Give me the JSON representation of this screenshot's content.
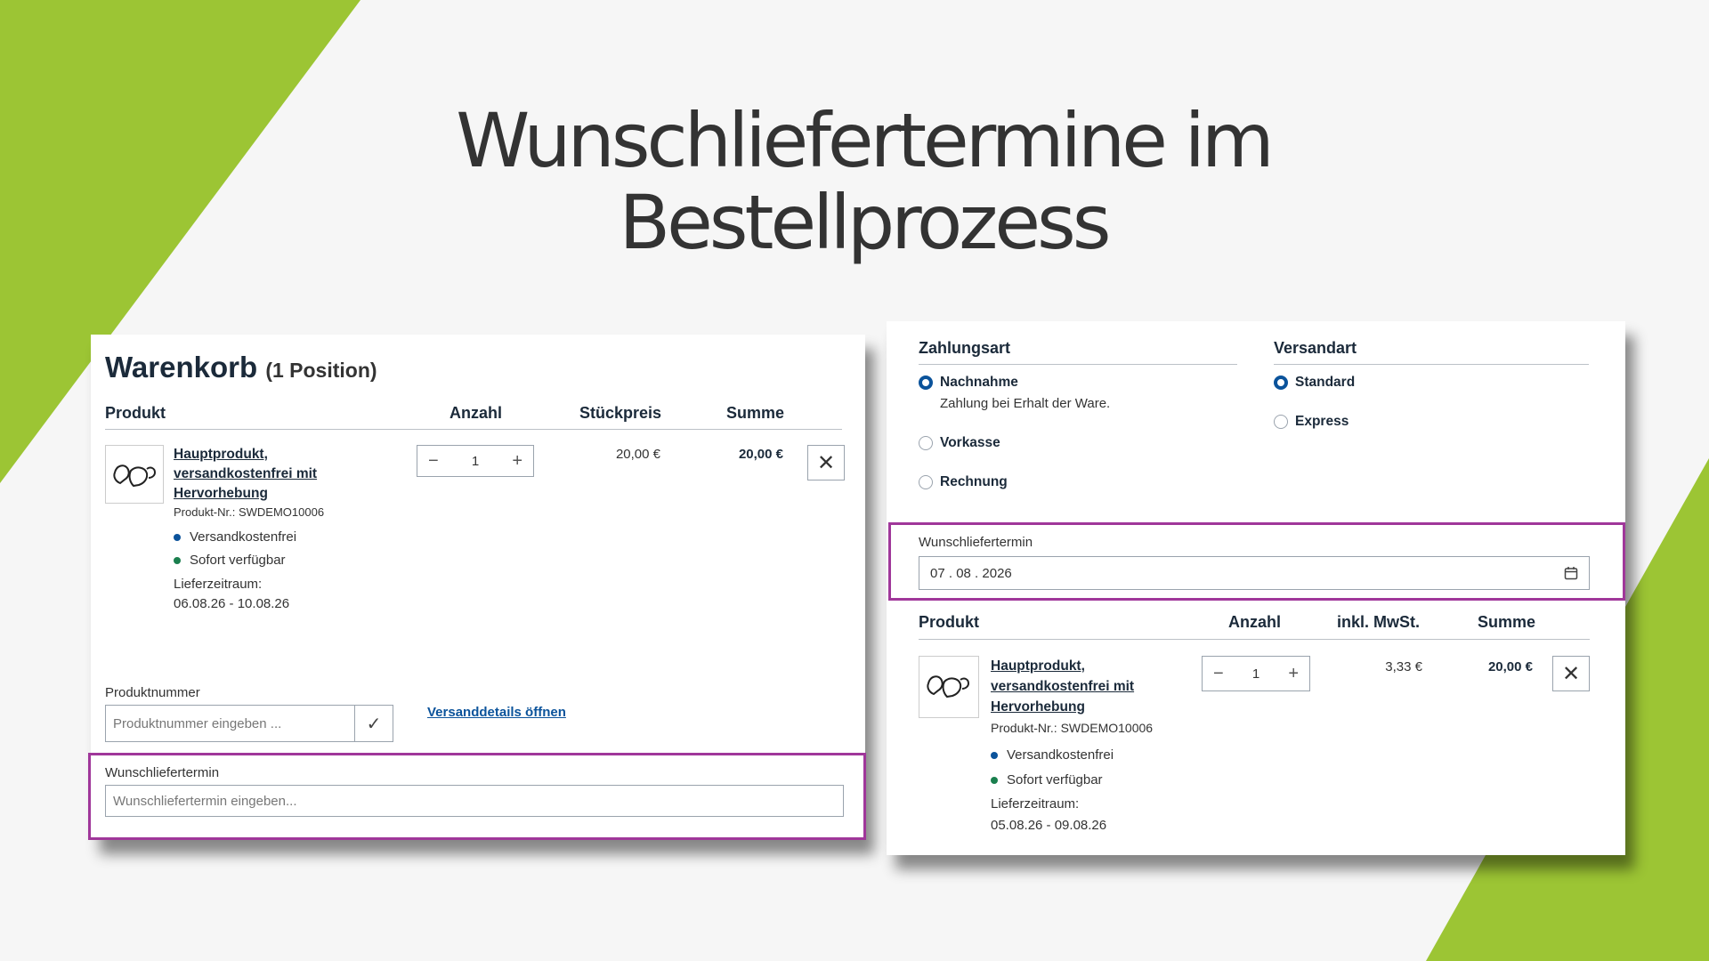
{
  "slide": {
    "title_line1": "Wunschliefertermine im",
    "title_line2": "Bestellprozess",
    "accent_color": "#9cc534",
    "highlight_color": "#a0379a"
  },
  "cart": {
    "heading": "Warenkorb",
    "count": "(1 Position)",
    "columns": {
      "product": "Produkt",
      "qty": "Anzahl",
      "unit_price": "Stückpreis",
      "total": "Summe"
    },
    "item": {
      "name_l1": "Hauptprodukt,",
      "name_l2": "versandkostenfrei mit",
      "name_l3": "Hervorhebung",
      "number": "Produkt-Nr.: SWDEMO10006",
      "badge1": "Versandkostenfrei",
      "badge2": "Sofort verfügbar",
      "delivery_label": "Lieferzeitraum:",
      "delivery_range": "06.08.26 - 10.08.26",
      "qty": "1",
      "qty_minus": "−",
      "qty_plus": "+",
      "unit_price": "20,00 €",
      "total": "20,00 €",
      "remove": "✕"
    },
    "product_number_label": "Produktnummer",
    "product_number_placeholder": "Produktnummer eingeben ...",
    "submit_icon": "✓",
    "shipping_link": "Versanddetails öffnen",
    "wish_label": "Wunschliefertermin",
    "wish_placeholder": "Wunschliefertermin eingeben..."
  },
  "checkout": {
    "payment_heading": "Zahlungsart",
    "shipping_heading": "Versandart",
    "payment_options": [
      {
        "label": "Nachnahme",
        "selected": true,
        "note": "Zahlung bei Erhalt der Ware."
      },
      {
        "label": "Vorkasse",
        "selected": false
      },
      {
        "label": "Rechnung",
        "selected": false
      }
    ],
    "shipping_options": [
      {
        "label": "Standard",
        "selected": true
      },
      {
        "label": "Express",
        "selected": false
      }
    ],
    "wish_label": "Wunschliefertermin",
    "wish_day": "07",
    "wish_month": "08",
    "wish_year": "2026",
    "columns": {
      "product": "Produkt",
      "qty": "Anzahl",
      "tax": "inkl. MwSt.",
      "total": "Summe"
    },
    "item": {
      "name_l1": "Hauptprodukt,",
      "name_l2": "versandkostenfrei mit",
      "name_l3": "Hervorhebung",
      "number": "Produkt-Nr.: SWDEMO10006",
      "badge1": "Versandkostenfrei",
      "badge2": "Sofort verfügbar",
      "delivery_label": "Lieferzeitraum:",
      "delivery_range": "05.08.26 - 09.08.26",
      "qty": "1",
      "qty_minus": "−",
      "qty_plus": "+",
      "tax": "3,33 €",
      "total": "20,00 €",
      "remove": "✕"
    }
  }
}
